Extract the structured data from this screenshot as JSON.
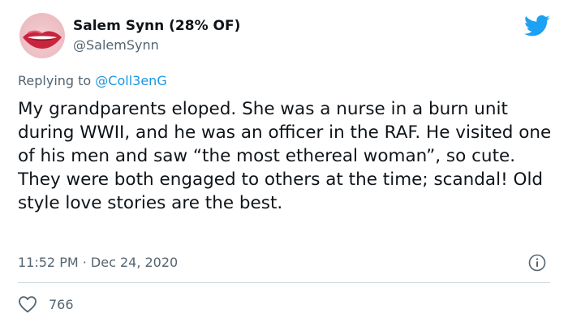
{
  "author": {
    "display_name": "Salem Synn (28% OF)",
    "handle": "@SalemSynn"
  },
  "reply": {
    "prefix": "Replying to ",
    "target": "@Coll3enG"
  },
  "tweet": {
    "text": "My grandparents eloped. She was a nurse in a burn unit during WWII, and he was an officer in the RAF. He visited one of his men and saw “the most ethereal woman”, so cute. They were both engaged to others at the time; scandal! Old style love stories are the best."
  },
  "meta": {
    "timestamp": "11:52 PM · Dec 24, 2020",
    "like_count": "766"
  },
  "icons": {
    "brand": "twitter-bird-icon",
    "info": "info-icon",
    "like": "heart-icon"
  },
  "colors": {
    "brand_blue": "#1da1f2",
    "link_blue": "#1b95e0",
    "secondary_text": "#536471",
    "divider": "#cfd9de"
  }
}
